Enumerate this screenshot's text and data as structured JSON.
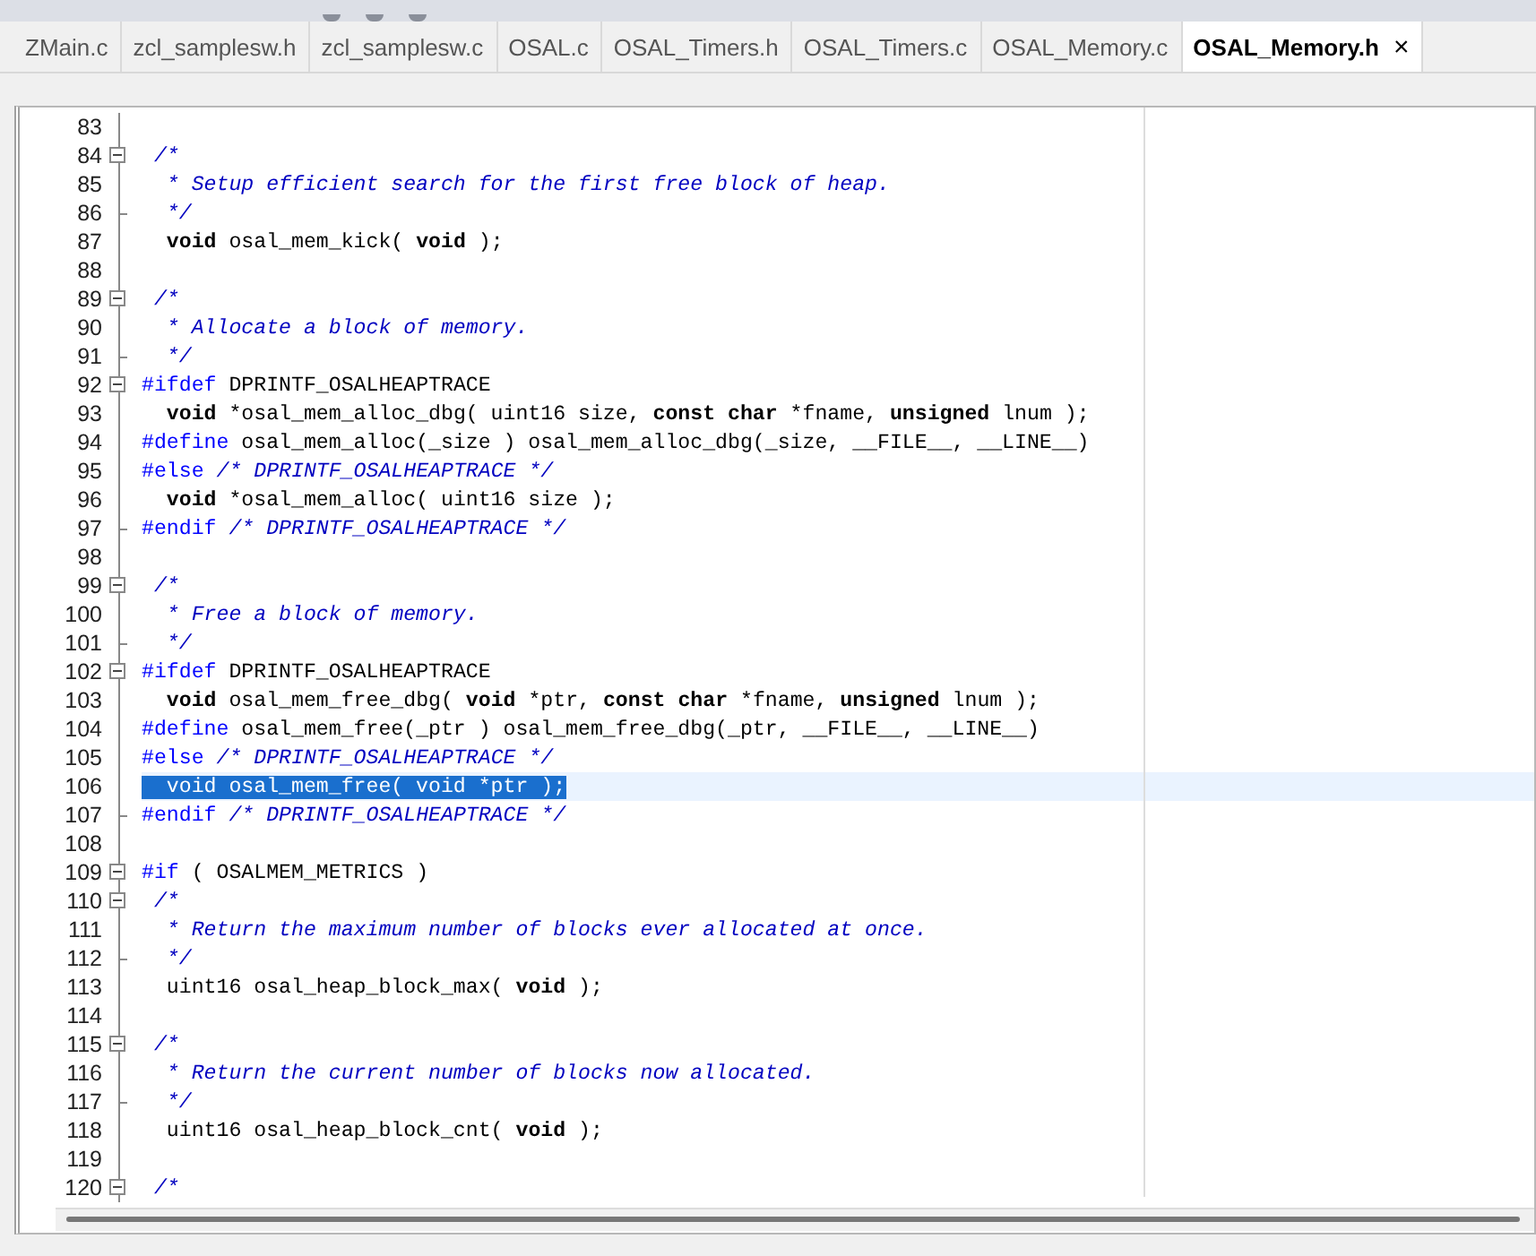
{
  "tabs": [
    {
      "label": "ZMain.c",
      "selected": false
    },
    {
      "label": "zcl_samplesw.h",
      "selected": false
    },
    {
      "label": "zcl_samplesw.c",
      "selected": false
    },
    {
      "label": "OSAL.c",
      "selected": false
    },
    {
      "label": "OSAL_Timers.h",
      "selected": false
    },
    {
      "label": "OSAL_Timers.c",
      "selected": false
    },
    {
      "label": "OSAL_Memory.c",
      "selected": false
    },
    {
      "label": "OSAL_Memory.h",
      "selected": true
    }
  ],
  "close_tab": "×",
  "editor": {
    "lines": [
      {
        "number": "83",
        "collapsible": false,
        "block_end": false,
        "selected": false
      },
      {
        "number": "84",
        "collapsible": true,
        "block_end": false,
        "selected": false,
        "tokens": [
          {
            "kind": "comment",
            "text": " /*"
          }
        ]
      },
      {
        "number": "85",
        "collapsible": false,
        "block_end": false,
        "selected": false,
        "tokens": [
          {
            "kind": "comment",
            "text": "  * Setup efficient search for the first free block of heap."
          }
        ]
      },
      {
        "number": "86",
        "collapsible": false,
        "block_end": true,
        "selected": false,
        "tokens": [
          {
            "kind": "comment",
            "text": "  */"
          }
        ]
      },
      {
        "number": "87",
        "collapsible": false,
        "block_end": false,
        "selected": false,
        "tokens": [
          {
            "kind": "keyword",
            "text": "  void"
          },
          {
            "kind": "plain",
            "text": " osal_mem_kick( "
          },
          {
            "kind": "keyword",
            "text": "void"
          },
          {
            "kind": "plain",
            "text": " );"
          }
        ]
      },
      {
        "number": "88",
        "collapsible": false,
        "block_end": false,
        "selected": false
      },
      {
        "number": "89",
        "collapsible": true,
        "block_end": false,
        "selected": false,
        "tokens": [
          {
            "kind": "comment",
            "text": " /*"
          }
        ]
      },
      {
        "number": "90",
        "collapsible": false,
        "block_end": false,
        "selected": false,
        "tokens": [
          {
            "kind": "comment",
            "text": "  * Allocate a block of memory."
          }
        ]
      },
      {
        "number": "91",
        "collapsible": false,
        "block_end": true,
        "selected": false,
        "tokens": [
          {
            "kind": "comment",
            "text": "  */"
          }
        ]
      },
      {
        "number": "92",
        "collapsible": true,
        "block_end": false,
        "selected": false,
        "tokens": [
          {
            "kind": "directive",
            "text": "#ifdef"
          },
          {
            "kind": "plain",
            "text": " DPRINTF_OSALHEAPTRACE"
          }
        ]
      },
      {
        "number": "93",
        "collapsible": false,
        "block_end": false,
        "selected": false,
        "tokens": [
          {
            "kind": "keyword",
            "text": "  void"
          },
          {
            "kind": "plain",
            "text": " *osal_mem_alloc_dbg( uint16 size, "
          },
          {
            "kind": "keyword",
            "text": "const char"
          },
          {
            "kind": "plain",
            "text": " *fname, "
          },
          {
            "kind": "keyword",
            "text": "unsigned"
          },
          {
            "kind": "plain",
            "text": " lnum );"
          }
        ]
      },
      {
        "number": "94",
        "collapsible": false,
        "block_end": false,
        "selected": false,
        "tokens": [
          {
            "kind": "directive",
            "text": "#define"
          },
          {
            "kind": "plain",
            "text": " osal_mem_alloc(_size ) osal_mem_alloc_dbg(_size, __FILE__, __LINE__)"
          }
        ]
      },
      {
        "number": "95",
        "collapsible": false,
        "block_end": false,
        "selected": false,
        "tokens": [
          {
            "kind": "directive",
            "text": "#else"
          },
          {
            "kind": "comment",
            "text": " /* DPRINTF_OSALHEAPTRACE */"
          }
        ]
      },
      {
        "number": "96",
        "collapsible": false,
        "block_end": false,
        "selected": false,
        "tokens": [
          {
            "kind": "keyword",
            "text": "  void"
          },
          {
            "kind": "plain",
            "text": " *osal_mem_alloc( uint16 size );"
          }
        ]
      },
      {
        "number": "97",
        "collapsible": false,
        "block_end": true,
        "selected": false,
        "tokens": [
          {
            "kind": "directive",
            "text": "#endif"
          },
          {
            "kind": "comment",
            "text": " /* DPRINTF_OSALHEAPTRACE */"
          }
        ]
      },
      {
        "number": "98",
        "collapsible": false,
        "block_end": false,
        "selected": false
      },
      {
        "number": "99",
        "collapsible": true,
        "block_end": false,
        "selected": false,
        "tokens": [
          {
            "kind": "comment",
            "text": " /*"
          }
        ]
      },
      {
        "number": "100",
        "collapsible": false,
        "block_end": false,
        "selected": false,
        "tokens": [
          {
            "kind": "comment",
            "text": "  * Free a block of memory."
          }
        ]
      },
      {
        "number": "101",
        "collapsible": false,
        "block_end": true,
        "selected": false,
        "tokens": [
          {
            "kind": "comment",
            "text": "  */"
          }
        ]
      },
      {
        "number": "102",
        "collapsible": true,
        "block_end": false,
        "selected": false,
        "tokens": [
          {
            "kind": "directive",
            "text": "#ifdef"
          },
          {
            "kind": "plain",
            "text": " DPRINTF_OSALHEAPTRACE"
          }
        ]
      },
      {
        "number": "103",
        "collapsible": false,
        "block_end": false,
        "selected": false,
        "tokens": [
          {
            "kind": "keyword",
            "text": "  void"
          },
          {
            "kind": "plain",
            "text": " osal_mem_free_dbg( "
          },
          {
            "kind": "keyword",
            "text": "void"
          },
          {
            "kind": "plain",
            "text": " *ptr, "
          },
          {
            "kind": "keyword",
            "text": "const char"
          },
          {
            "kind": "plain",
            "text": " *fname, "
          },
          {
            "kind": "keyword",
            "text": "unsigned"
          },
          {
            "kind": "plain",
            "text": " lnum );"
          }
        ]
      },
      {
        "number": "104",
        "collapsible": false,
        "block_end": false,
        "selected": false,
        "tokens": [
          {
            "kind": "directive",
            "text": "#define"
          },
          {
            "kind": "plain",
            "text": " osal_mem_free(_ptr ) osal_mem_free_dbg(_ptr, __FILE__, __LINE__)"
          }
        ]
      },
      {
        "number": "105",
        "collapsible": false,
        "block_end": false,
        "selected": false,
        "tokens": [
          {
            "kind": "directive",
            "text": "#else"
          },
          {
            "kind": "comment",
            "text": " /* DPRINTF_OSALHEAPTRACE */"
          }
        ]
      },
      {
        "number": "106",
        "collapsible": false,
        "block_end": false,
        "selected": true,
        "tokens": [
          {
            "kind": "plain",
            "text": "  void osal_mem_free( void *ptr );"
          }
        ]
      },
      {
        "number": "107",
        "collapsible": false,
        "block_end": true,
        "selected": false,
        "tokens": [
          {
            "kind": "directive",
            "text": "#endif"
          },
          {
            "kind": "comment",
            "text": " /* DPRINTF_OSALHEAPTRACE */"
          }
        ]
      },
      {
        "number": "108",
        "collapsible": false,
        "block_end": false,
        "selected": false
      },
      {
        "number": "109",
        "collapsible": true,
        "block_end": false,
        "selected": false,
        "tokens": [
          {
            "kind": "directive",
            "text": "#if"
          },
          {
            "kind": "plain",
            "text": " ( OSALMEM_METRICS )"
          }
        ]
      },
      {
        "number": "110",
        "collapsible": true,
        "block_end": false,
        "selected": false,
        "tokens": [
          {
            "kind": "comment",
            "text": " /*"
          }
        ]
      },
      {
        "number": "111",
        "collapsible": false,
        "block_end": false,
        "selected": false,
        "tokens": [
          {
            "kind": "comment",
            "text": "  * Return the maximum number of blocks ever allocated at once."
          }
        ]
      },
      {
        "number": "112",
        "collapsible": false,
        "block_end": true,
        "selected": false,
        "tokens": [
          {
            "kind": "comment",
            "text": "  */"
          }
        ]
      },
      {
        "number": "113",
        "collapsible": false,
        "block_end": false,
        "selected": false,
        "tokens": [
          {
            "kind": "plain",
            "text": "  uint16 osal_heap_block_max( "
          },
          {
            "kind": "keyword",
            "text": "void"
          },
          {
            "kind": "plain",
            "text": " );"
          }
        ]
      },
      {
        "number": "114",
        "collapsible": false,
        "block_end": false,
        "selected": false
      },
      {
        "number": "115",
        "collapsible": true,
        "block_end": false,
        "selected": false,
        "tokens": [
          {
            "kind": "comment",
            "text": " /*"
          }
        ]
      },
      {
        "number": "116",
        "collapsible": false,
        "block_end": false,
        "selected": false,
        "tokens": [
          {
            "kind": "comment",
            "text": "  * Return the current number of blocks now allocated."
          }
        ]
      },
      {
        "number": "117",
        "collapsible": false,
        "block_end": true,
        "selected": false,
        "tokens": [
          {
            "kind": "comment",
            "text": "  */"
          }
        ]
      },
      {
        "number": "118",
        "collapsible": false,
        "block_end": false,
        "selected": false,
        "tokens": [
          {
            "kind": "plain",
            "text": "  uint16 osal_heap_block_cnt( "
          },
          {
            "kind": "keyword",
            "text": "void"
          },
          {
            "kind": "plain",
            "text": " );"
          }
        ]
      },
      {
        "number": "119",
        "collapsible": false,
        "block_end": false,
        "selected": false
      },
      {
        "number": "120",
        "collapsible": true,
        "block_end": false,
        "selected": false,
        "tokens": [
          {
            "kind": "comment",
            "text": " /*"
          }
        ]
      }
    ]
  }
}
